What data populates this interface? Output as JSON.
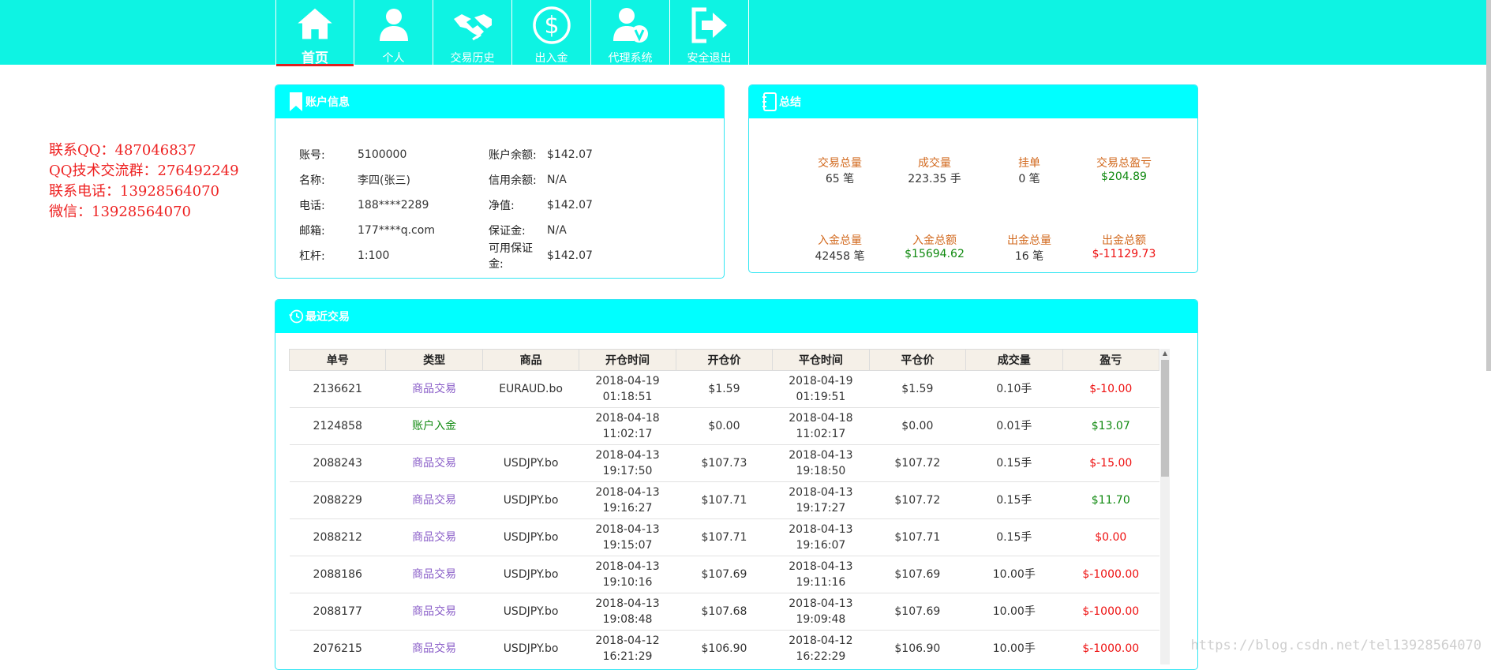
{
  "nav": {
    "items": [
      {
        "label": "首页",
        "icon": "home-icon",
        "active": true
      },
      {
        "label": "个人",
        "icon": "user-icon"
      },
      {
        "label": "交易历史",
        "icon": "handshake-icon"
      },
      {
        "label": "出入金",
        "icon": "dollar-icon"
      },
      {
        "label": "代理系统",
        "icon": "agent-icon"
      },
      {
        "label": "安全退出",
        "icon": "logout-icon"
      }
    ]
  },
  "contact": {
    "qq": "联系QQ：487046837",
    "qq_group": "QQ技术交流群：276492249",
    "phone": "联系电话：13928564070",
    "wechat": "微信：13928564070"
  },
  "account": {
    "title": "账户信息",
    "rows": [
      {
        "k1": "账号:",
        "v1": "5100000",
        "k2": "账户余额:",
        "v2": "$142.07"
      },
      {
        "k1": "名称:",
        "v1": "李四(张三)",
        "k2": "信用余额:",
        "v2": "N/A"
      },
      {
        "k1": "电话:",
        "v1": "188****2289",
        "k2": "净值:",
        "v2": "$142.07"
      },
      {
        "k1": "邮箱:",
        "v1": "177****q.com",
        "k2": "保证金:",
        "v2": "N/A"
      },
      {
        "k1": "杠杆:",
        "v1": "1:100",
        "k2": "可用保证金:",
        "v2": "$142.07"
      }
    ]
  },
  "summary": {
    "title": "总结",
    "row1": [
      {
        "label": "交易总量",
        "value": "65 笔"
      },
      {
        "label": "成交量",
        "value": "223.35 手"
      },
      {
        "label": "挂单",
        "value": "0 笔"
      },
      {
        "label": "交易总盈亏",
        "value": "$204.89"
      }
    ],
    "row2": [
      {
        "label": "入金总量",
        "value": "42458 笔"
      },
      {
        "label": "入金总额",
        "value": "$15694.62"
      },
      {
        "label": "出金总量",
        "value": "16 笔"
      },
      {
        "label": "出金总额",
        "value": "$-11129.73"
      }
    ]
  },
  "recent": {
    "title": "最近交易",
    "columns": [
      "单号",
      "类型",
      "商品",
      "开仓时间",
      "开仓价",
      "平仓时间",
      "平仓价",
      "成交量",
      "盈亏"
    ],
    "rows": [
      [
        "2136621",
        "商品交易",
        "EURAUD.bo",
        "2018-04-19",
        "01:18:51",
        "$1.59",
        "2018-04-19",
        "01:19:51",
        "$1.59",
        "0.10手",
        "$-10.00"
      ],
      [
        "2124858",
        "账户入金",
        "",
        "2018-04-18",
        "11:02:17",
        "$0.00",
        "2018-04-18",
        "11:02:17",
        "$0.00",
        "0.01手",
        "$13.07"
      ],
      [
        "2088243",
        "商品交易",
        "USDJPY.bo",
        "2018-04-13",
        "19:17:50",
        "$107.73",
        "2018-04-13",
        "19:18:50",
        "$107.72",
        "0.15手",
        "$-15.00"
      ],
      [
        "2088229",
        "商品交易",
        "USDJPY.bo",
        "2018-04-13",
        "19:16:27",
        "$107.71",
        "2018-04-13",
        "19:17:27",
        "$107.72",
        "0.15手",
        "$11.70"
      ],
      [
        "2088212",
        "商品交易",
        "USDJPY.bo",
        "2018-04-13",
        "19:15:07",
        "$107.71",
        "2018-04-13",
        "19:16:07",
        "$107.71",
        "0.15手",
        "$0.00"
      ],
      [
        "2088186",
        "商品交易",
        "USDJPY.bo",
        "2018-04-13",
        "19:10:16",
        "$107.69",
        "2018-04-13",
        "19:11:16",
        "$107.69",
        "10.00手",
        "$-1000.00"
      ],
      [
        "2088177",
        "商品交易",
        "USDJPY.bo",
        "2018-04-13",
        "19:08:48",
        "$107.68",
        "2018-04-13",
        "19:09:48",
        "$107.69",
        "10.00手",
        "$-1000.00"
      ],
      [
        "2076215",
        "商品交易",
        "USDJPY.bo",
        "2018-04-12",
        "16:21:29",
        "$106.90",
        "2018-04-12",
        "16:22:29",
        "$106.90",
        "10.00手",
        "$-1000.00"
      ]
    ]
  },
  "watermark": "https://blog.csdn.net/tel13928564070",
  "colors": {
    "header_bg": "#0ef3e3",
    "panel_head": "#00ffff",
    "positive": "#118a11",
    "negative": "#ee1111",
    "type_trade": "#8a5ec8",
    "label_orange": "#d2691e"
  }
}
